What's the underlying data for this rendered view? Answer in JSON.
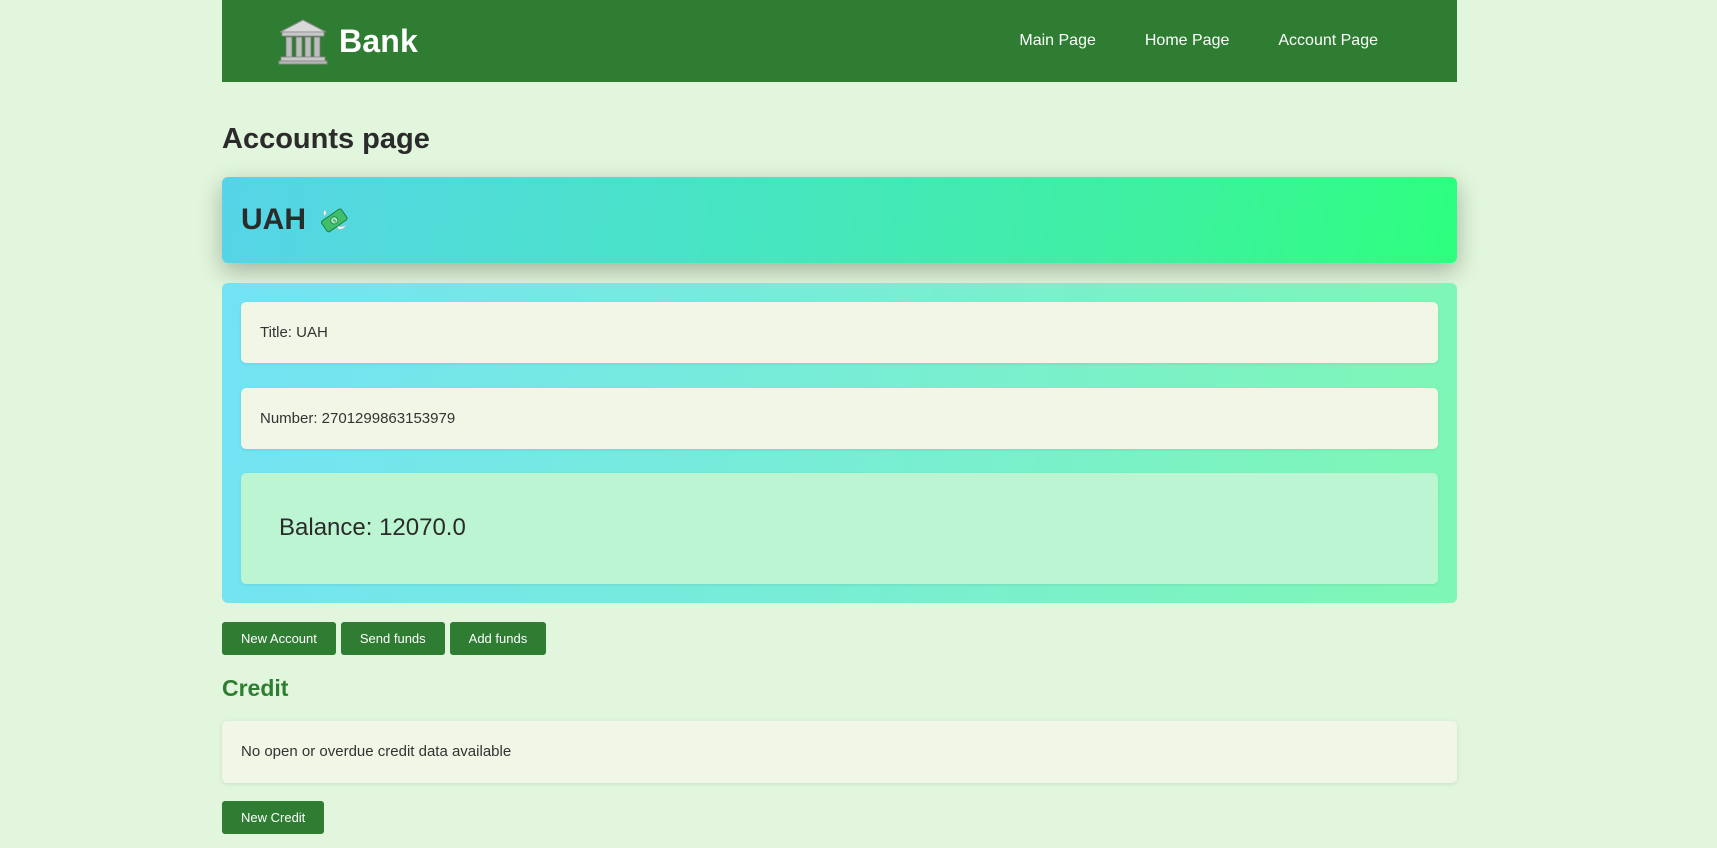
{
  "header": {
    "brand_name": "Bank",
    "logo_icon": "bank-building-icon",
    "nav": [
      {
        "label": "Main Page"
      },
      {
        "label": "Home Page"
      },
      {
        "label": "Account Page"
      }
    ]
  },
  "page": {
    "title": "Accounts page"
  },
  "account": {
    "code": "UAH",
    "currency_icon": "flying-money-icon",
    "title_line": "Title: UAH",
    "number_line": "Number: 2701299863153979",
    "balance_line": "Balance: 12070.0"
  },
  "actions": {
    "new_account": "New Account",
    "send_funds": "Send funds",
    "add_funds": "Add funds"
  },
  "credit": {
    "heading": "Credit",
    "message": "No open or overdue credit data available",
    "new_credit": "New Credit"
  },
  "colors": {
    "primary": "#2e7d32",
    "background": "#e1f6dc"
  }
}
